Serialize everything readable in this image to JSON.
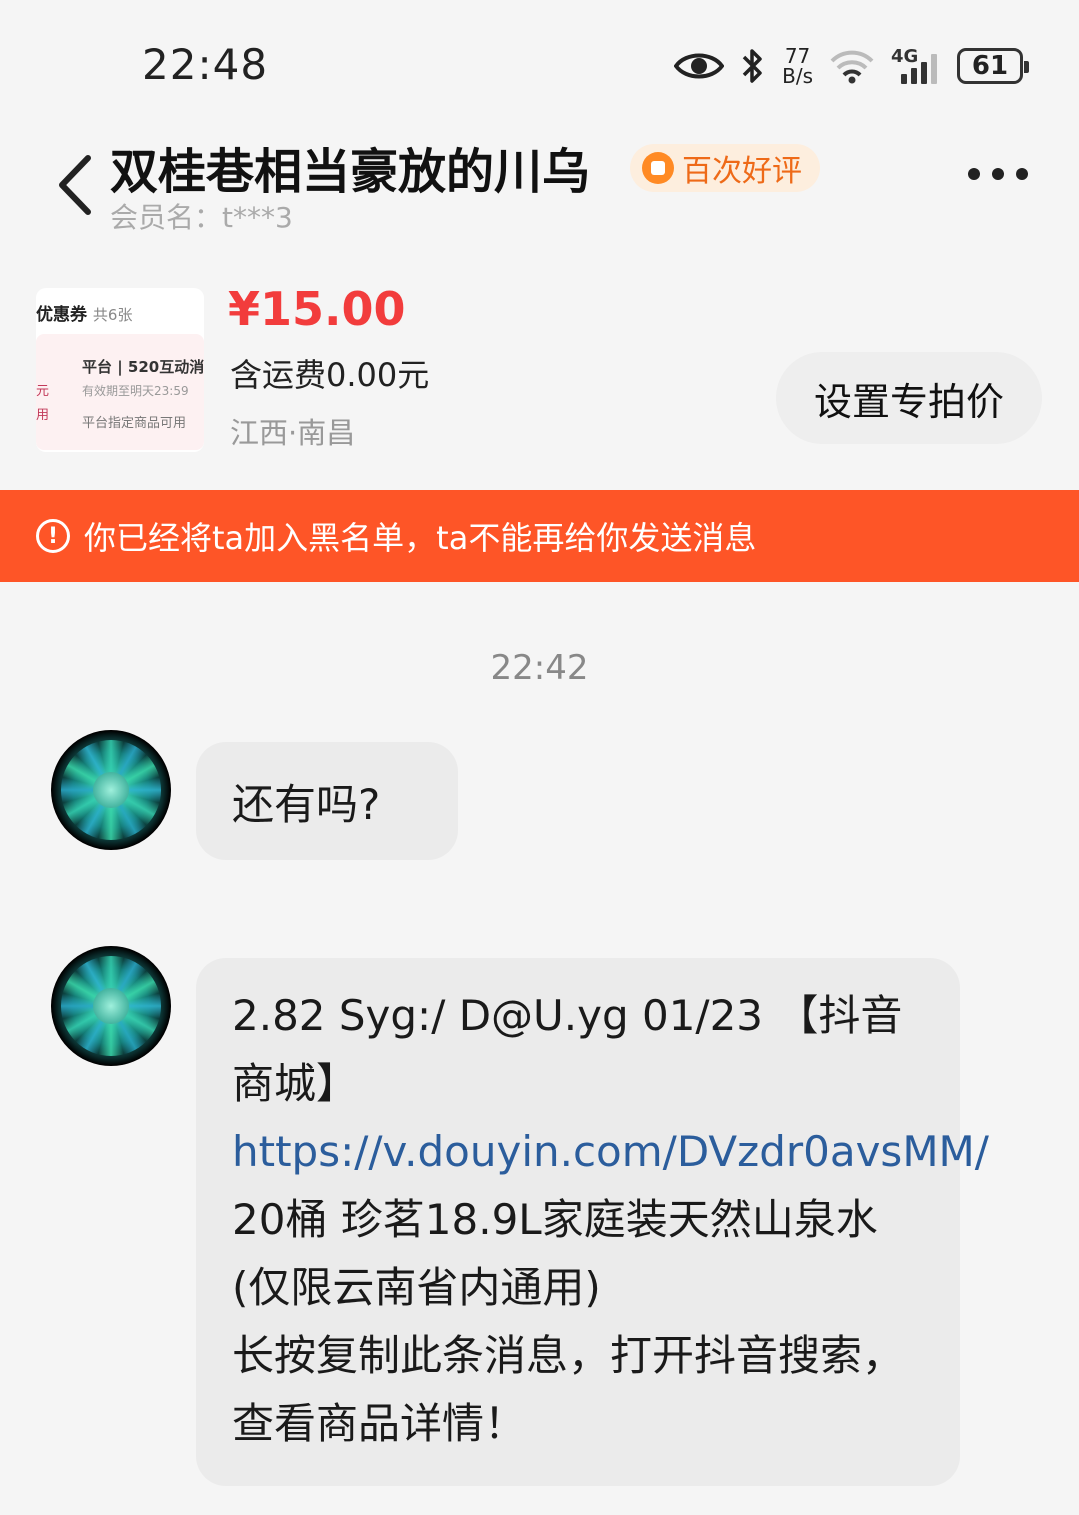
{
  "status_bar": {
    "time": "22:48",
    "speed_value": "77",
    "speed_unit": "B/s",
    "network": "4G",
    "battery": "61"
  },
  "header": {
    "title": "双桂巷相当豪放的川乌",
    "badge": "百次好评",
    "member": "会员名：t***3"
  },
  "product": {
    "thumb_title": "优惠券",
    "thumb_count": "共6张",
    "coupon_line1": "平台 | 520互动消",
    "coupon_line2": "有效期至明天23:59",
    "coupon_line3": "平台指定商品可用",
    "coupon_left1": "元",
    "coupon_left2": "用",
    "price": "¥15.00",
    "shipping": "含运费0.00元",
    "location": "江西·南昌",
    "set_price_label": "设置专拍价"
  },
  "banner": {
    "icon": "!",
    "text": "你已经将ta加入黑名单，ta不能再给你发送消息"
  },
  "chat": {
    "time": "22:42",
    "messages": [
      {
        "text": "还有吗?"
      },
      {
        "text_a": "2.82 Syg:/ D@U.yg 01/23 【抖音商城】",
        "link": "https://v.douyin.com/DVzdr0avsMM/",
        "text_b": " 20桶 珍茗18.9L家庭装天然山泉水(仅限云南省内通用)",
        "text_c": "长按复制此条消息，打开抖音搜索，查看商品详情！"
      }
    ]
  },
  "colors": {
    "banner": "#fe5527",
    "price": "#f23c3c",
    "badge_text": "#ee6a18",
    "link": "#2b5d9c"
  }
}
